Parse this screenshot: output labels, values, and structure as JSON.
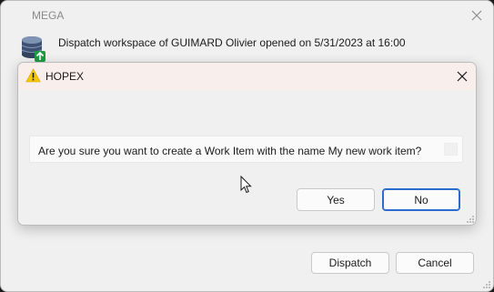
{
  "mega_window": {
    "title": "MEGA",
    "message": "Dispatch workspace of GUIMARD Olivier opened on 5/31/2023 at 16:00",
    "icon": "database-upload-icon",
    "buttons": {
      "dispatch": "Dispatch",
      "cancel": "Cancel"
    }
  },
  "hopex_dialog": {
    "title": "HOPEX",
    "icon": "warning-icon",
    "question": "Are you sure you want to create a Work Item with the name My new work item?",
    "buttons": {
      "yes": "Yes",
      "no": "No"
    },
    "default_button": "no"
  },
  "colors": {
    "hopex_titlebar": "#f8eeec",
    "warning_yellow": "#f6c60b",
    "focus_blue": "#2b6bd0",
    "db_icon_green": "#1f9a45"
  }
}
